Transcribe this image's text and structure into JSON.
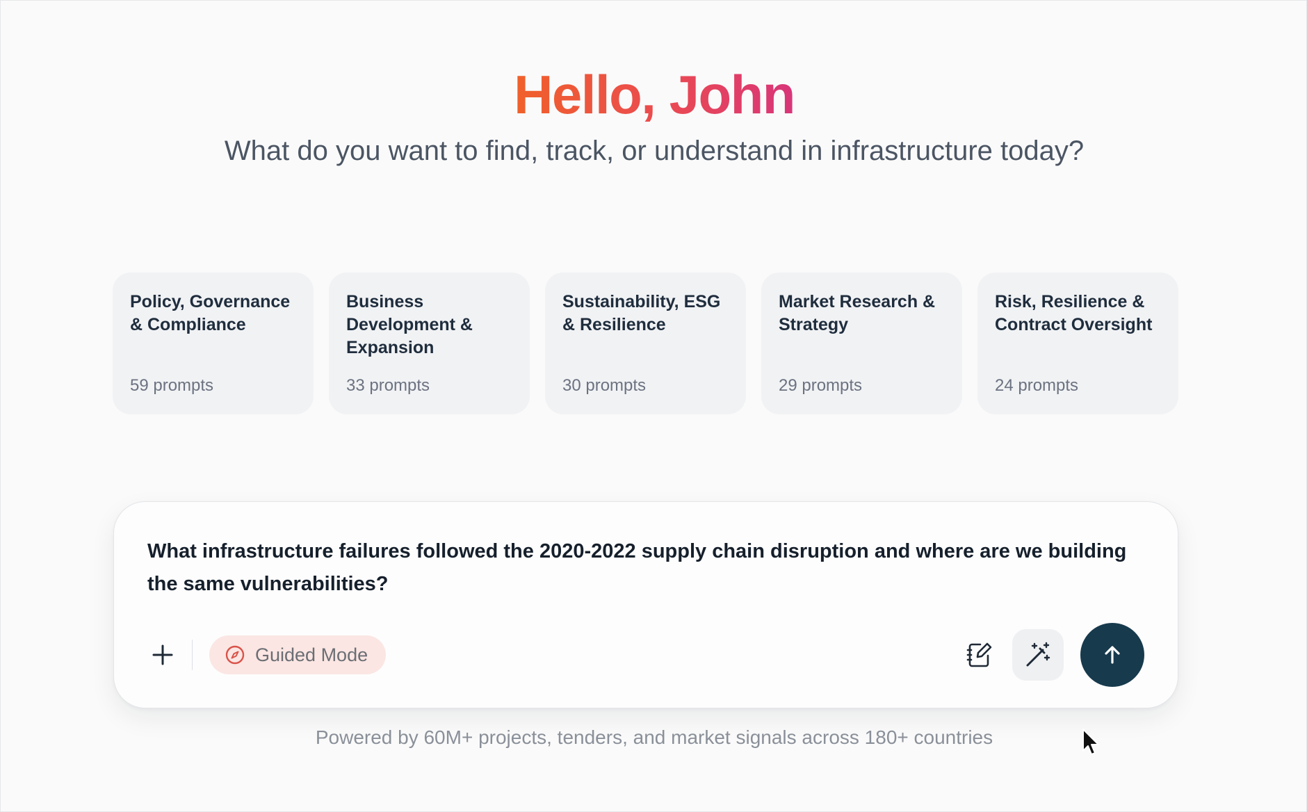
{
  "hero": {
    "greeting": "Hello, John",
    "subtitle": "What do you want to find, track, or understand in infrastructure today?"
  },
  "categories": [
    {
      "title": "Policy, Governance & Compliance",
      "count": "59 prompts"
    },
    {
      "title": "Business Development & Expansion",
      "count": "33 prompts"
    },
    {
      "title": "Sustainability, ESG & Resilience",
      "count": "30 prompts"
    },
    {
      "title": "Market Research & Strategy",
      "count": "29 prompts"
    },
    {
      "title": "Risk, Resilience & Contract Oversight",
      "count": "24 prompts"
    }
  ],
  "composer": {
    "text": "What infrastructure failures followed the 2020-2022 supply chain disruption and where are we building the same vulnerabilities?",
    "guided_mode_label": "Guided Mode",
    "icons": {
      "add": "plus-icon",
      "guided": "compass-icon",
      "notes": "notebook-edit-icon",
      "magic": "magic-wand-icon",
      "send": "arrow-up-icon"
    }
  },
  "footer": {
    "note": "Powered by 60M+ projects, tenders, and market signals across 180+ countries"
  },
  "colors": {
    "greeting_gradient_start": "#f0612a",
    "greeting_gradient_end": "#d8357a",
    "send_button": "#173a4d",
    "guided_bg": "#fbe6e3",
    "card_bg": "#f1f2f4"
  }
}
